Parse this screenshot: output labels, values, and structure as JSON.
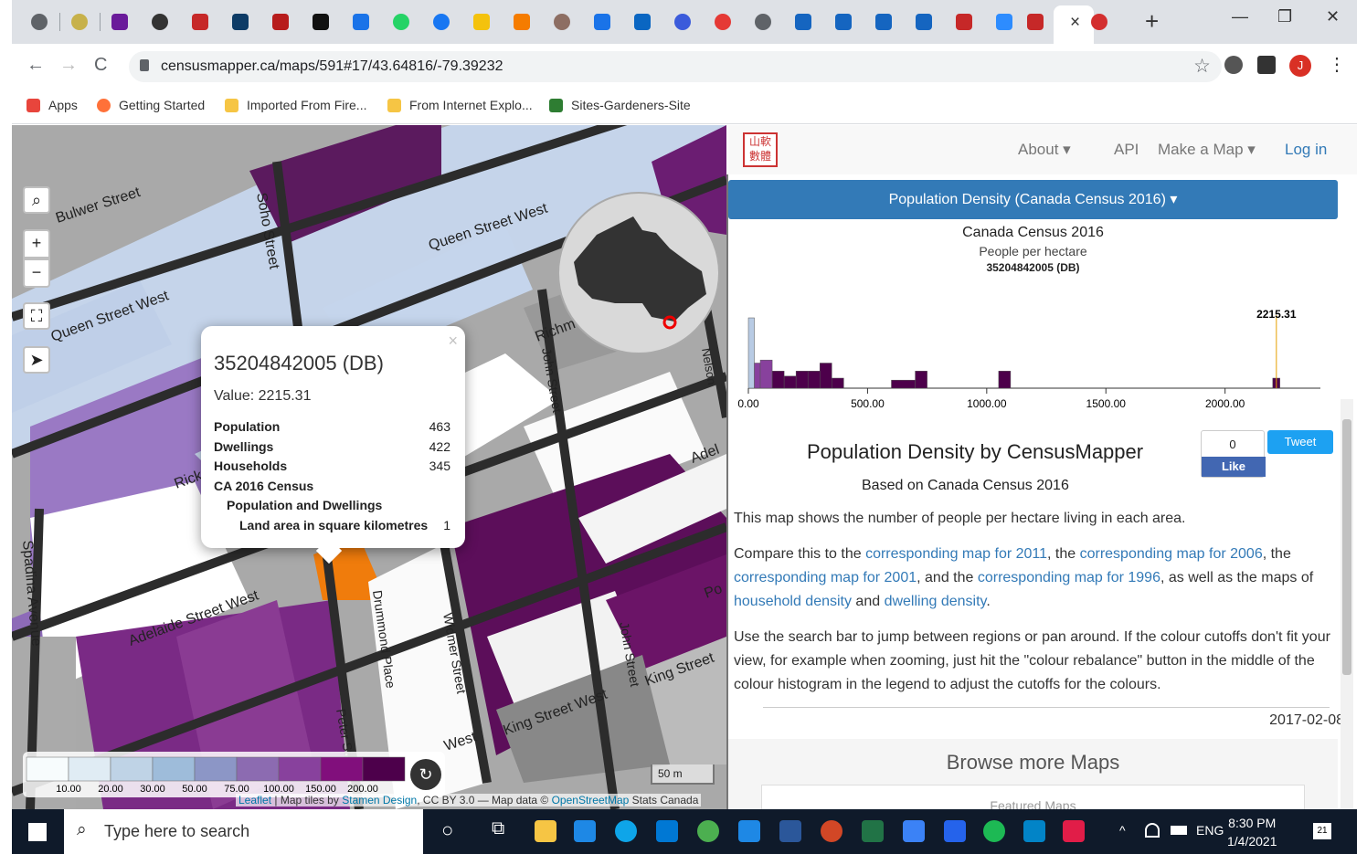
{
  "browser": {
    "tab_close": "×",
    "new_tab": "+",
    "window_minimize": "—",
    "window_restore": "❐",
    "window_close": "✕",
    "url": "censusmapper.ca/maps/591#17/43.64816/-79.39232",
    "back": "←",
    "forward": "→",
    "reload": "C",
    "profile_initial": "J",
    "bookmarks": [
      "Apps",
      "Getting Started",
      "Imported From Fire...",
      "From Internet Explo...",
      "Sites-Gardeners-Site"
    ]
  },
  "site": {
    "logo": "山軟數體",
    "nav": {
      "about": "About ▾",
      "api": "API",
      "make_map": "Make a Map ▾",
      "login": "Log in"
    },
    "map_selector": "Population Density (Canada Census 2016) ▾",
    "histogram": {
      "title": "Canada Census 2016",
      "subtitle": "People per hectare",
      "region": "35204842005 (DB)",
      "marker_value": "2215.31"
    },
    "article": {
      "title": "Population Density by CensusMapper",
      "subtitle": "Based on Canada Census 2016",
      "p1": "This map shows the number of people per hectare living in each area.",
      "p2_a": "Compare this to the ",
      "p2_l1": "corresponding map for 2011",
      "p2_b": ", the ",
      "p2_l2": "corresponding map for 2006",
      "p2_c": ", the ",
      "p2_l3": "corresponding map for 2001",
      "p2_d": ", and the ",
      "p2_l4": "corresponding map for 1996",
      "p2_e": ", as well as the maps of ",
      "p2_l5": "household density",
      "p2_f": " and ",
      "p2_l6": "dwelling density",
      "p2_g": ".",
      "p3": "Use the search bar to jump between regions or pan around. If the colour cutoffs don't fit your view, for example when zooming, just hit the \"colour rebalance\" button in the middle of the colour histogram in the legend to adjust the cutoffs for the colours.",
      "date": "2017-02-08",
      "browse": "Browse more Maps",
      "featured": "Featured Maps"
    },
    "social": {
      "like_count": "0",
      "like": "Like",
      "tweet": "Tweet"
    }
  },
  "map": {
    "streets": [
      "Bulwer Street",
      "Soho Street",
      "Queen Street West",
      "Queen Street West",
      "Richmond",
      "John Street",
      "Adelaide Street West",
      "Spadina Avenue",
      "Drummond Place",
      "Widmer Street",
      "John Street",
      "King Street West",
      "King Street",
      "Peter Street",
      "Adel",
      "Nelson",
      "West",
      "Rick",
      "Po"
    ],
    "popup": {
      "title": "35204842005 (DB)",
      "value": "Value: 2215.31",
      "close": "×",
      "rows": [
        [
          "Population",
          "463"
        ],
        [
          "Dwellings",
          "422"
        ],
        [
          "Households",
          "345"
        ]
      ],
      "section": "CA 2016 Census",
      "subsection": "Population and Dwellings",
      "land_label": "Land area in square kilometres",
      "land_value": "1"
    },
    "controls": {
      "zoom_in": "+",
      "zoom_out": "−"
    },
    "legend_ticks": [
      "10.00",
      "20.00",
      "30.00",
      "50.00",
      "75.00",
      "100.00",
      "150.00",
      "200.00"
    ],
    "scale": "50 m",
    "attribution": {
      "a": "Leaflet",
      "b": " | Map tiles by ",
      "c": "Stamen Design",
      "d": ", CC BY 3.0",
      "e": " — Map data © ",
      "f": "OpenStreetMap",
      "g": " Stats Canada"
    }
  },
  "chart_data": {
    "type": "bar",
    "title": "Canada Census 2016",
    "subtitle": "People per hectare",
    "xlabel": "",
    "ylabel": "",
    "x_ticks": [
      "0.00",
      "500.00",
      "1000.00",
      "1500.00",
      "2000.00"
    ],
    "xlim": [
      0,
      2400
    ],
    "series": [
      {
        "values": [
          [
            0,
            25,
            70
          ],
          [
            25,
            50,
            25
          ],
          [
            50,
            100,
            28
          ],
          [
            100,
            150,
            17
          ],
          [
            150,
            200,
            12
          ],
          [
            200,
            250,
            17
          ],
          [
            250,
            300,
            17
          ],
          [
            300,
            350,
            25
          ],
          [
            350,
            400,
            10
          ],
          [
            600,
            700,
            8
          ],
          [
            700,
            750,
            17
          ],
          [
            1050,
            1100,
            17
          ],
          [
            2200,
            2230,
            10
          ]
        ]
      }
    ],
    "marker": 2215.31,
    "colors": [
      "#b8cbe4",
      "#8c96c6",
      "#88419d",
      "#6e016b",
      "#4d004b"
    ]
  },
  "taskbar": {
    "search_placeholder": "Type here to search",
    "time": "8:30 PM",
    "date": "1/4/2021",
    "lang": "ENG",
    "notif": "21"
  }
}
